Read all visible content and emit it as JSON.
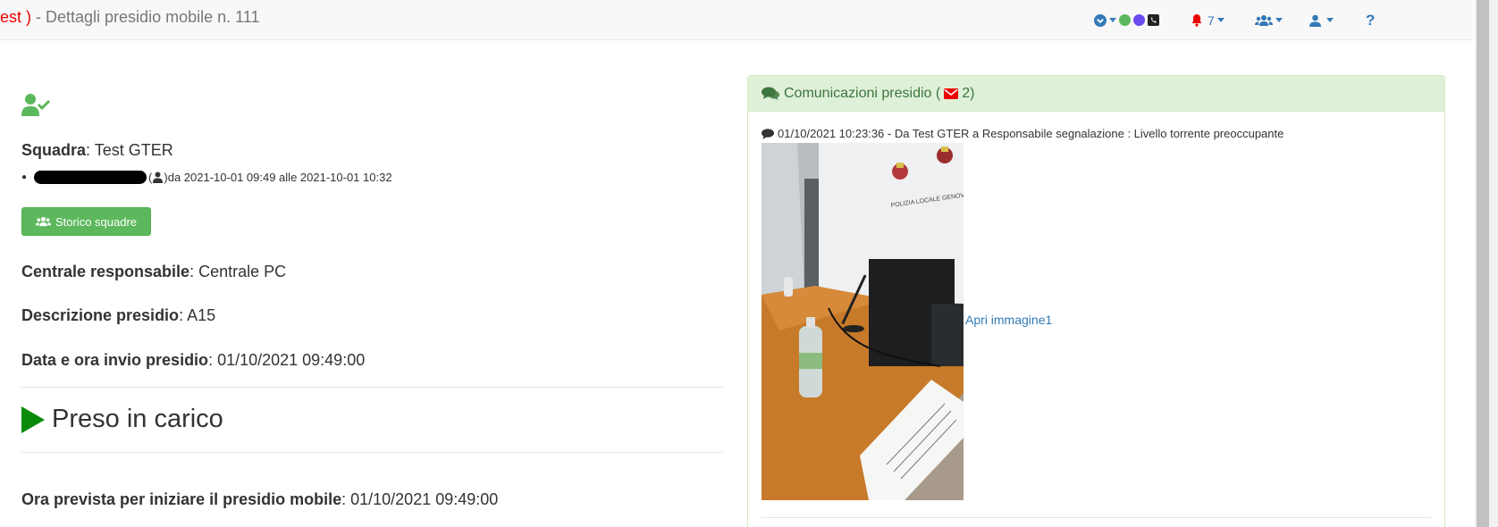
{
  "navbar": {
    "title_env_fragment": "est )",
    "title_rest": " - Dettagli presidio mobile n. 111",
    "notifications_count": "7",
    "help_label": "?"
  },
  "left": {
    "team_label": "Squadra",
    "team_value": ": Test GTER",
    "member_period": " da 2021-10-01 09:49 alle 2021-10-01 10:32",
    "history_button": "Storico squadre",
    "central_label": "Centrale responsabile",
    "central_value": ": Centrale PC",
    "description_label": "Descrizione presidio",
    "description_value": ": A15",
    "sent_label": "Data e ora invio presidio",
    "sent_value": ": 01/10/2021 09:49:00",
    "status": "Preso in carico",
    "start_label": "Ora prevista per iniziare il presidio mobile",
    "start_value": ": 01/10/2021 09:49:00"
  },
  "panel": {
    "title": "Comunicazioni presidio (",
    "count": "2)",
    "message": "01/10/2021 10:23:36 - Da Test GTER a Responsabile segnalazione : Livello torrente preoccupante",
    "photo_sign": "POLIZIA LOCALE GENOVA",
    "image_link": "Apri immagine1"
  },
  "colors": {
    "accent": "#337ab7",
    "success": "#5cb85c",
    "panel_header_bg": "#dff0d8",
    "panel_header_text": "#3c763d",
    "alert": "#e00000",
    "status_play": "#0a8a0a"
  },
  "icons": {
    "team_check": "user-check-icon",
    "users": "users-icon",
    "play": "play-icon",
    "comments": "comments-icon",
    "envelope": "envelope-icon",
    "comment": "comment-icon"
  }
}
